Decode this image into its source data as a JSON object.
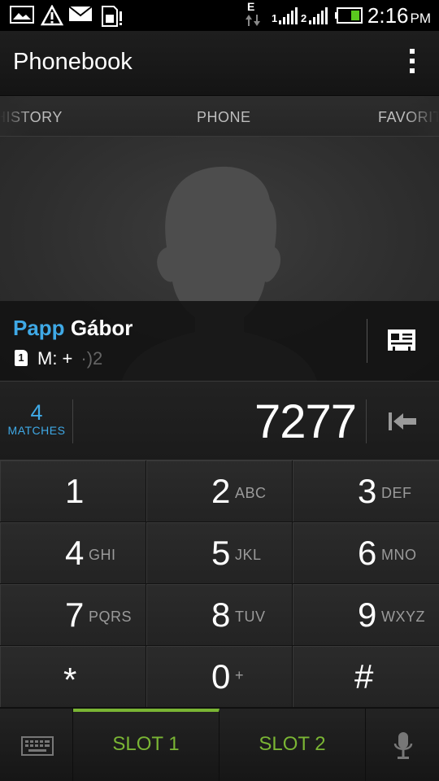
{
  "status_bar": {
    "time": "2:16",
    "ampm": "PM",
    "network_type": "E",
    "sim1_label": "1",
    "sim2_label": "2",
    "icons": [
      "gallery-icon",
      "alert-triangle-icon",
      "mail-icon",
      "sim-alert-icon",
      "data-arrows-icon",
      "signal-sim1-icon",
      "signal-sim2-icon",
      "battery-icon"
    ]
  },
  "header": {
    "title": "Phonebook",
    "menu_icon": "overflow-menu-icon"
  },
  "tabs": [
    {
      "label": "HISTORY"
    },
    {
      "label": "PHONE"
    },
    {
      "label": "FAVORITES"
    }
  ],
  "contact": {
    "name_highlight": "Papp",
    "name_rest": "Gábor",
    "sim_slot": "1",
    "number_label": "M: +",
    "number_blurred": "·)2",
    "card_icon": "contact-card-icon"
  },
  "dialer": {
    "matches_count": "4",
    "matches_label": "MATCHES",
    "number": "7277",
    "backspace_icon": "backspace-icon"
  },
  "keypad": [
    {
      "digit": "1",
      "letters": ""
    },
    {
      "digit": "2",
      "letters": "ABC"
    },
    {
      "digit": "3",
      "letters": "DEF"
    },
    {
      "digit": "4",
      "letters": "GHI"
    },
    {
      "digit": "5",
      "letters": "JKL"
    },
    {
      "digit": "6",
      "letters": "MNO"
    },
    {
      "digit": "7",
      "letters": "PQRS"
    },
    {
      "digit": "8",
      "letters": "TUV"
    },
    {
      "digit": "9",
      "letters": "WXYZ"
    },
    {
      "digit": "*",
      "letters": ""
    },
    {
      "digit": "0",
      "letters": "+"
    },
    {
      "digit": "#",
      "letters": ""
    }
  ],
  "bottom_bar": {
    "keyboard_icon": "keyboard-icon",
    "slot1_label": "SLOT 1",
    "slot2_label": "SLOT 2",
    "mic_icon": "microphone-icon"
  },
  "colors": {
    "accent_blue": "#3fa9e6",
    "accent_green": "#7ab534"
  }
}
